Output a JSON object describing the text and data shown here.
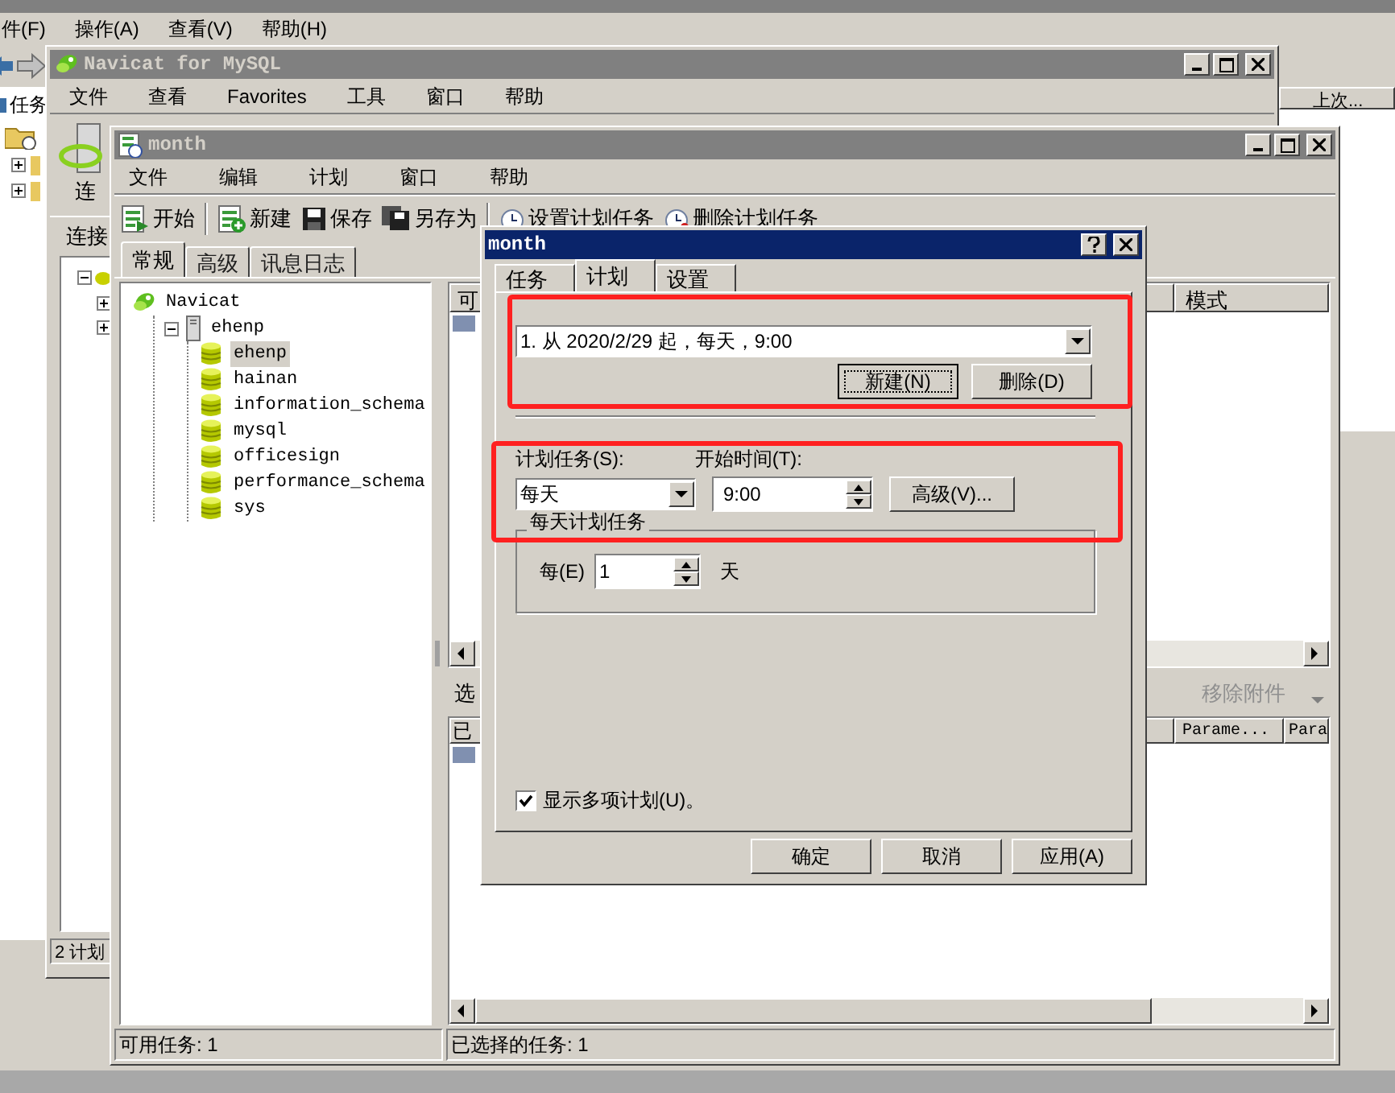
{
  "back_window": {
    "menu": [
      "件(F)",
      "操作(A)",
      "查看(V)",
      "帮助(H)"
    ],
    "tree_label": "任务",
    "tree_nodes": [
      {
        "expanded": false
      },
      {
        "expanded": false
      }
    ],
    "column_header": "上次...",
    "status": "2 计划"
  },
  "navicat_window": {
    "title": "Navicat for MySQL",
    "menu": [
      "文件",
      "查看",
      "Favorites",
      "工具",
      "窗口",
      "帮助"
    ],
    "toolbar_label": "连",
    "pane_header": "连接",
    "tree_nodes": [
      {
        "expanded": true
      },
      {
        "expanded": false
      },
      {
        "expanded": false
      }
    ]
  },
  "month_window": {
    "title": "month",
    "menu": [
      "文件",
      "编辑",
      "计划",
      "窗口",
      "帮助"
    ],
    "toolbar": [
      {
        "label": "开始",
        "kind": "start"
      },
      {
        "label": "新建",
        "kind": "new"
      },
      {
        "label": "保存",
        "kind": "save"
      },
      {
        "label": "另存为",
        "kind": "saveas"
      },
      {
        "label": "设置计划任务",
        "kind": "schedule"
      },
      {
        "label": "删除计划任务",
        "kind": "unschedule"
      }
    ],
    "tabs": [
      {
        "label": "常规",
        "selected": true
      },
      {
        "label": "高级",
        "selected": false
      },
      {
        "label": "讯息日志",
        "selected": false
      }
    ],
    "tree": [
      {
        "label": "Navicat",
        "kind": "root",
        "children": [
          {
            "label": "ehenp",
            "kind": "server",
            "expanded": true,
            "children": [
              {
                "label": "ehenp",
                "kind": "database",
                "selected": true
              },
              {
                "label": "hainan",
                "kind": "database",
                "selected": false
              },
              {
                "label": "information_schema",
                "kind": "database",
                "selected": false
              },
              {
                "label": "mysql",
                "kind": "database",
                "selected": false
              },
              {
                "label": "officesign",
                "kind": "database",
                "selected": false
              },
              {
                "label": "performance_schema",
                "kind": "database",
                "selected": false
              },
              {
                "label": "sys",
                "kind": "database",
                "selected": false
              }
            ]
          }
        ]
      }
    ],
    "upper_list": {
      "column_1": "可",
      "column_2": "模式"
    },
    "lower_toolbar": {
      "label": "选",
      "remove_attachment": {
        "label": "移除附件",
        "disabled": true
      }
    },
    "lower_list": {
      "column_1": "已",
      "column_2": "Parame...",
      "column_3": "Para"
    },
    "status_bar": [
      "可用任务: 1",
      "已选择的任务: 1"
    ]
  },
  "dialog": {
    "title": "month",
    "tabs": [
      {
        "label": "任务",
        "selected": false
      },
      {
        "label": "计划",
        "selected": true
      },
      {
        "label": "设置",
        "selected": false
      }
    ],
    "schedule": "1. 从 2020/2/29 起，每天，9:00",
    "new_button": "新建(N)",
    "delete_button": "删除(D)",
    "schedule_type_label": "计划任务(S):",
    "schedule_type": "每天",
    "start_time_label": "开始时间(T):",
    "start_time": "9:00",
    "advanced_button": "高级(V)...",
    "group_title": "每天计划任务",
    "every_label": "每(E)",
    "every_value": "1",
    "every_unit": "天",
    "show_multiple": {
      "label": "显示多项计划(U)。",
      "checked": true
    },
    "buttons": [
      "确定",
      "取消",
      "应用(A)"
    ]
  }
}
